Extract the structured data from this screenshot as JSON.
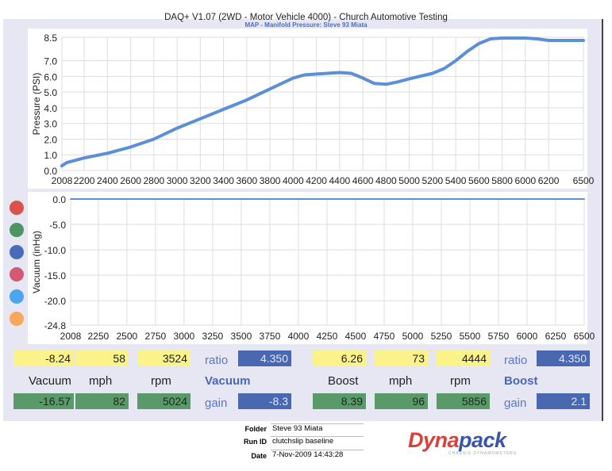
{
  "header": {
    "title": "DAQ+ V1.07 (2WD - Motor Vehicle 4000) - Church Automotive Testing",
    "subtitle": "MAP - Manifold Pressure: Steve 93 Miata"
  },
  "chart_data": [
    {
      "type": "line",
      "title": "MAP - Manifold Pressure: Steve 93 Miata",
      "xlabel": "",
      "ylabel": "Pressure (PSI)",
      "xlim": [
        2008,
        6500
      ],
      "ylim": [
        0,
        8.5
      ],
      "xticks": [
        2008,
        2200,
        2400,
        2600,
        2800,
        3000,
        3200,
        3400,
        3600,
        3800,
        4000,
        4200,
        4400,
        4600,
        4800,
        5000,
        5200,
        5400,
        5600,
        5800,
        6000,
        6200,
        6500
      ],
      "yticks": [
        "0.0",
        "1.0",
        "2.0",
        "3.0",
        "4.0",
        "5.0",
        "6.0",
        "7.0",
        "8.5"
      ],
      "ytick_values": [
        0,
        1,
        2,
        3,
        4,
        5,
        6,
        7,
        8.5
      ],
      "grid": true,
      "color": "#5b8fd8",
      "x": [
        2008,
        2050,
        2200,
        2400,
        2600,
        2800,
        3000,
        3200,
        3400,
        3600,
        3800,
        4000,
        4100,
        4200,
        4400,
        4500,
        4600,
        4700,
        4800,
        4900,
        5000,
        5200,
        5300,
        5400,
        5500,
        5600,
        5700,
        5800,
        6000,
        6100,
        6200,
        6500
      ],
      "y": [
        0.3,
        0.5,
        0.8,
        1.1,
        1.5,
        2.0,
        2.7,
        3.3,
        3.9,
        4.5,
        5.2,
        5.9,
        6.1,
        6.15,
        6.25,
        6.2,
        5.9,
        5.55,
        5.5,
        5.65,
        5.85,
        6.2,
        6.5,
        7.0,
        7.6,
        8.1,
        8.4,
        8.45,
        8.45,
        8.4,
        8.3,
        8.3
      ]
    },
    {
      "type": "line",
      "xlabel": "",
      "ylabel": "Vacuum (inHg)",
      "xlim": [
        2008,
        6500
      ],
      "ylim": [
        -24.8,
        0
      ],
      "xticks": [
        2008,
        2250,
        2500,
        2750,
        3000,
        3250,
        3500,
        3750,
        4000,
        4250,
        4500,
        4750,
        5000,
        5250,
        5500,
        5750,
        6000,
        6250,
        6500
      ],
      "yticks": [
        "0.0",
        "-5.0",
        "-10.0",
        "-15.0",
        "-20.0",
        "-24.8"
      ],
      "ytick_values": [
        0,
        -5,
        -10,
        -15,
        -20,
        -24.8
      ],
      "grid": true,
      "color": "#5b8fd8",
      "x": [
        2008,
        6500
      ],
      "y": [
        0,
        0
      ]
    }
  ],
  "legend_dots": [
    "#d9534a",
    "#4f9463",
    "#4a6cb8",
    "#d45a72",
    "#4aa6ee",
    "#f6a95a"
  ],
  "readouts": {
    "vac_top": {
      "vacuum": "-8.24",
      "mph": "58",
      "rpm": "3524",
      "ratio_label": "ratio",
      "ratio": "4.350"
    },
    "vac_labels": {
      "vacuum": "Vacuum",
      "mph": "mph",
      "rpm": "rpm",
      "section": "Vacuum"
    },
    "vac_bot": {
      "vacuum": "-16.57",
      "mph": "82",
      "rpm": "5024",
      "gain_label": "gain",
      "gain": "-8.3"
    },
    "boost_top": {
      "boost": "6.26",
      "mph": "73",
      "rpm": "4444",
      "ratio_label": "ratio",
      "ratio": "4.350"
    },
    "boost_labels": {
      "boost": "Boost",
      "mph": "mph",
      "rpm": "rpm",
      "section": "Boost"
    },
    "boost_bot": {
      "boost": "8.39",
      "mph": "96",
      "rpm": "5856",
      "gain_label": "gain",
      "gain": "2.1"
    }
  },
  "footer": {
    "folder_label": "Folder",
    "folder": "Steve 93 Miata",
    "runid_label": "Run ID",
    "runid": "clutchslip baseline",
    "date_label": "Date",
    "date": "7-Nov-2009 14:43:28",
    "logo_a": "Dyna",
    "logo_b": "pack",
    "logo_tag": "CHASSIS DYNAMOMETERS"
  }
}
